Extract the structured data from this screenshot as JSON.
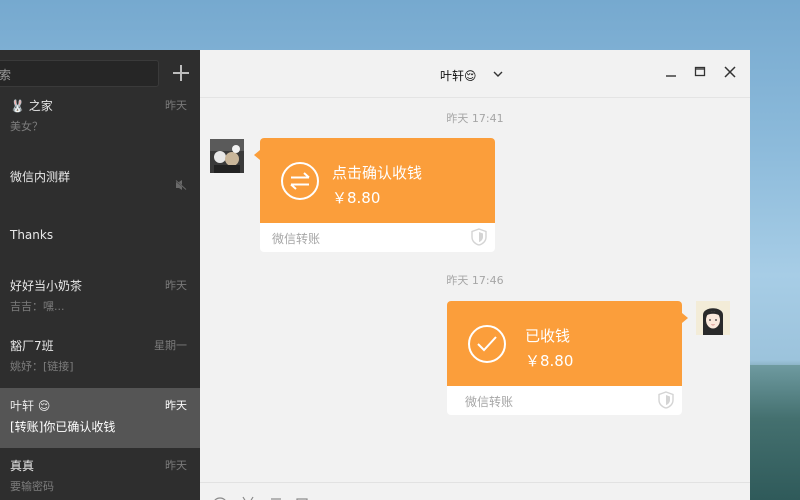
{
  "sidebar": {
    "search_placeholder": "搜索",
    "search_visible": "搜索",
    "add_label": "+",
    "chats": [
      {
        "name": "🐰 之家",
        "time": "昨天",
        "preview": "美女？"
      },
      {
        "name": "微信内测群",
        "time": "",
        "preview": "",
        "muted": true
      },
      {
        "name": "Thanks",
        "time": "",
        "preview": ""
      },
      {
        "name": "好好当小奶茶",
        "time": "昨天",
        "preview": "吉吉：嘿..."
      },
      {
        "name": "豁厂7班",
        "time": "星期一",
        "preview": "姚妤：[链接]"
      },
      {
        "name": "叶轩 😌",
        "time": "昨天",
        "preview": "[转账]你已确认收钱",
        "active": true
      },
      {
        "name": "真真",
        "time": "昨天",
        "preview": "要输密码"
      }
    ]
  },
  "chat": {
    "title": "叶轩😌",
    "messages": [
      {
        "timestamp": "昨天 17:41",
        "sender": "other",
        "type": "transfer",
        "title": "点击确认收钱",
        "amount": "￥8.80",
        "footer": "微信转账",
        "icon": "transfer-arrows-icon"
      },
      {
        "timestamp": "昨天 17:46",
        "sender": "self",
        "type": "transfer",
        "title": "已收钱",
        "amount": "￥8.80",
        "footer": "微信转账",
        "icon": "check-circle-icon"
      }
    ]
  },
  "colors": {
    "transfer_orange": "#fb9e3b",
    "sidebar_bg": "#2e2e2e",
    "sidebar_active": "#555555",
    "chat_bg": "#f2f2f2"
  }
}
